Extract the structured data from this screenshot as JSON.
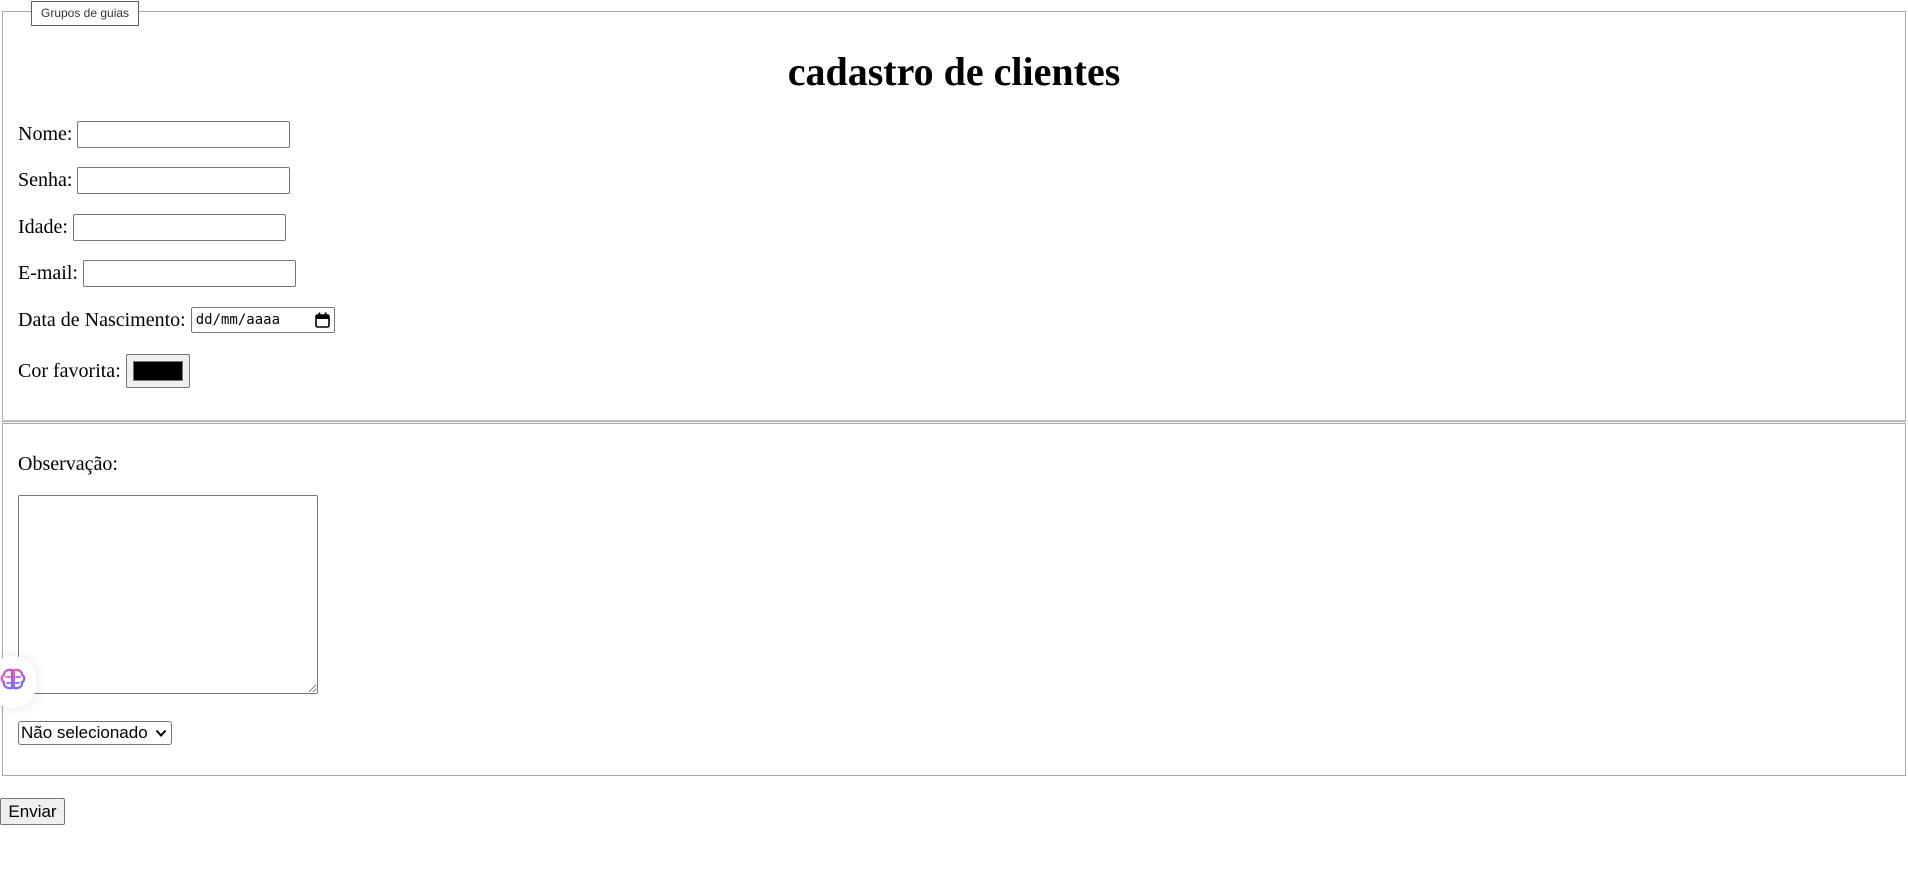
{
  "tab_group": {
    "label": "Grupos de guias"
  },
  "form": {
    "title": "cadastro de clientes",
    "fields": {
      "nome": {
        "label": "Nome:",
        "value": ""
      },
      "senha": {
        "label": "Senha:",
        "value": ""
      },
      "idade": {
        "label": "Idade:",
        "value": ""
      },
      "email": {
        "label": "E-mail:",
        "value": ""
      },
      "nascimento": {
        "label": "Data de Nascimento:",
        "placeholder": "dd/mm/aaaa"
      },
      "cor": {
        "label": "Cor favorita:",
        "value": "#000000"
      }
    },
    "observacao": {
      "label": "Observação:",
      "value": ""
    },
    "select": {
      "selected": "Não selecionado"
    },
    "submit_label": "Enviar"
  },
  "colors": {
    "fieldset_border": "#a9a9a9",
    "control_border": "#767676",
    "button_bg": "#efefef"
  },
  "icons": {
    "calendar": "calendar-icon",
    "dropdown": "chevron-down-icon",
    "extension": "brain-icon"
  }
}
